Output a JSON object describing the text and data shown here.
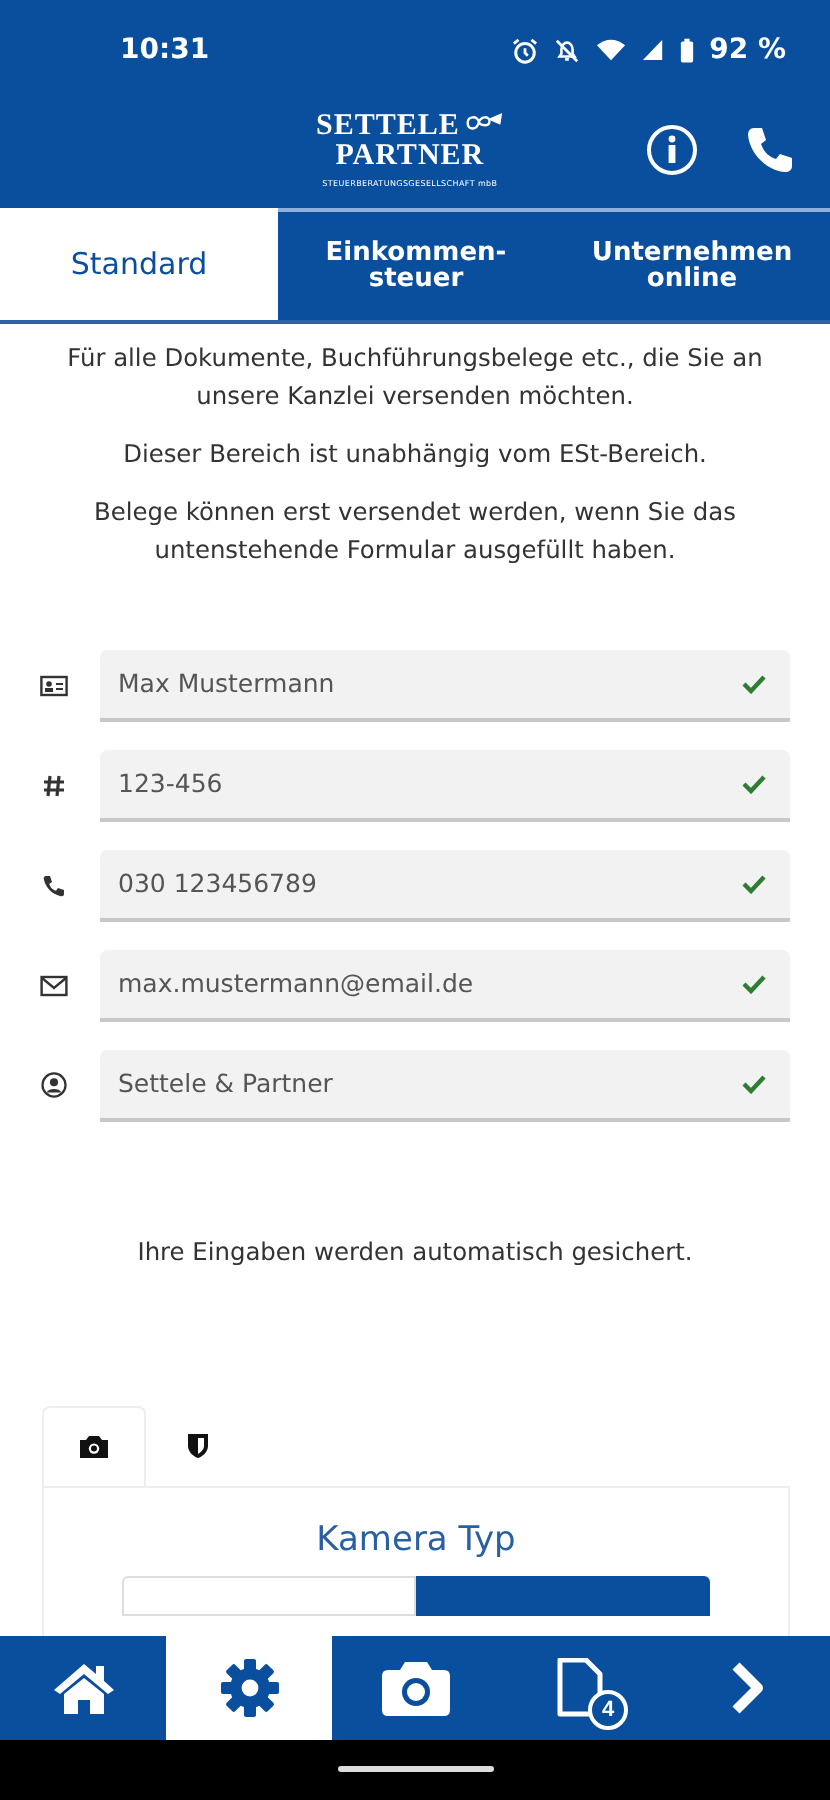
{
  "status_bar": {
    "time": "10:31",
    "battery": "92 %"
  },
  "header": {
    "logo_line1": "SETTELE",
    "logo_line2": "PARTNER",
    "logo_subtitle": "STEUERBERATUNGSGESELLSCHAFT mbB"
  },
  "tabs": [
    {
      "label": "Standard",
      "selected": true
    },
    {
      "label": "Einkommen-\nsteuer",
      "selected": false
    },
    {
      "label": "Unternehmen\nonline",
      "selected": false
    }
  ],
  "intro": [
    "Für alle Dokumente, Buchführungsbelege etc., die Sie an unsere Kanzlei versenden möchten.",
    "Dieser Bereich ist unabhängig vom ESt-Bereich.",
    "Belege können erst versendet werden, wenn Sie das untenstehende Formular ausgefüllt haben."
  ],
  "fields": [
    {
      "kind": "name",
      "value": "Max Mustermann",
      "valid": true
    },
    {
      "kind": "number",
      "value": "123-456",
      "valid": true
    },
    {
      "kind": "phone",
      "value": "030 123456789",
      "valid": true
    },
    {
      "kind": "email",
      "value": "max.mustermann@email.de",
      "valid": true
    },
    {
      "kind": "person",
      "value": "Settele & Partner",
      "valid": true
    }
  ],
  "autosave_note": "Ihre Eingaben werden automatisch gesichert.",
  "sub_tabs": [
    {
      "kind": "camera",
      "selected": true
    },
    {
      "kind": "shield",
      "selected": false
    }
  ],
  "camera_card": {
    "title": "Kamera Typ",
    "segments": [
      {
        "selected": false
      },
      {
        "selected": true
      }
    ]
  },
  "bottom_nav": [
    {
      "kind": "home",
      "selected": false
    },
    {
      "kind": "settings",
      "selected": true
    },
    {
      "kind": "camera",
      "selected": false
    },
    {
      "kind": "documents",
      "selected": false,
      "badge": "4"
    },
    {
      "kind": "next",
      "selected": false
    }
  ]
}
